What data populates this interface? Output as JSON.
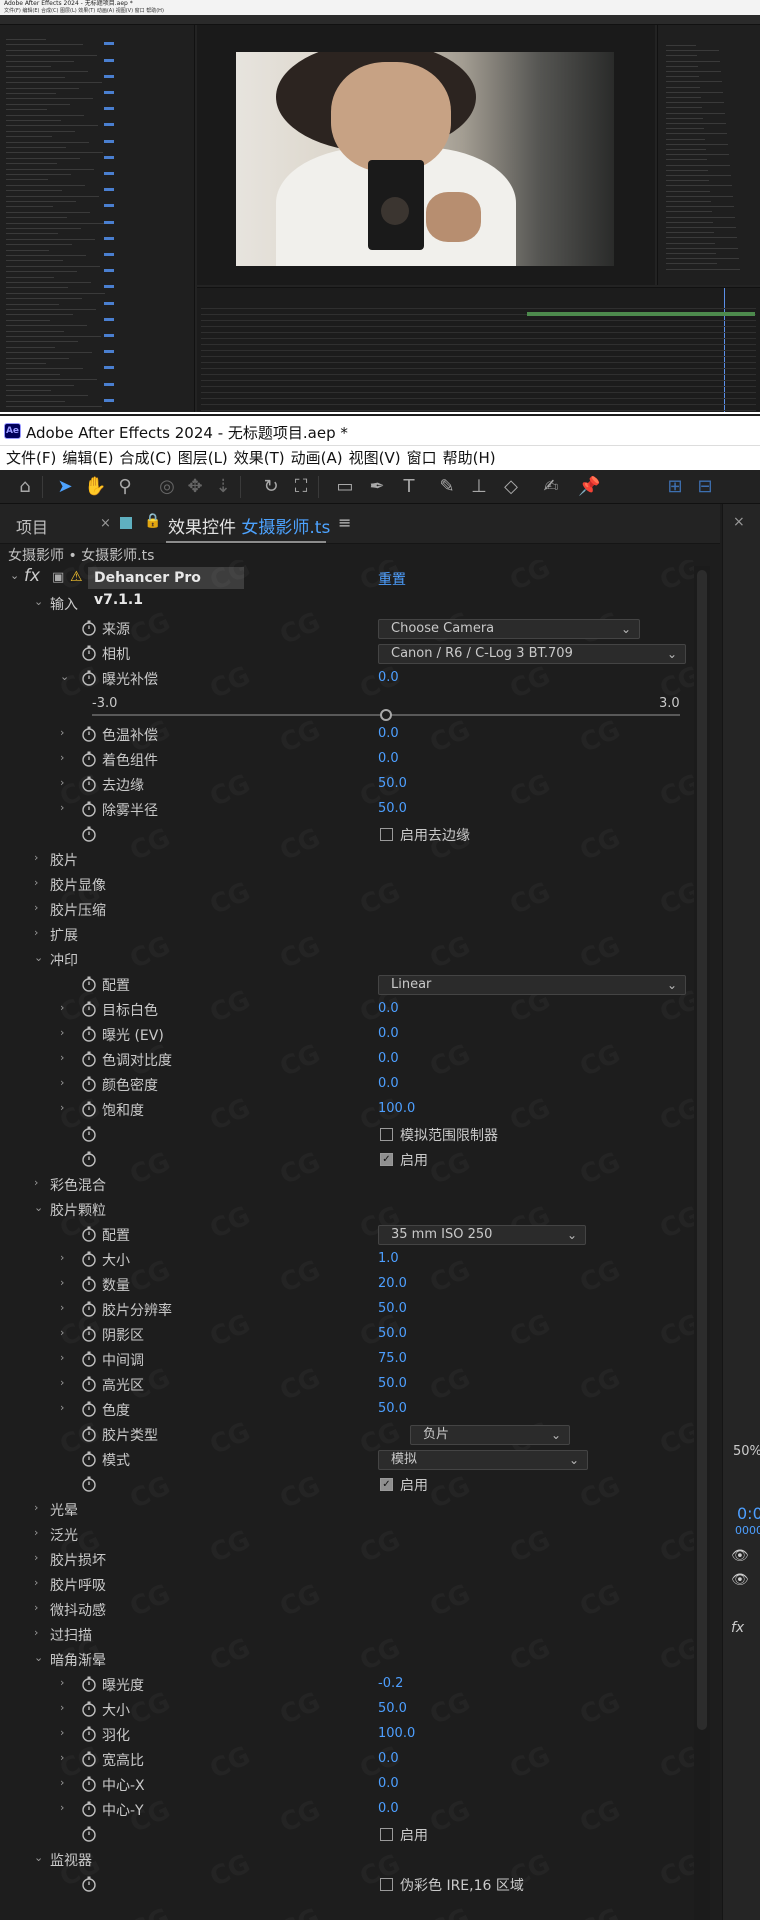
{
  "window": {
    "title": "Adobe After Effects 2024 - 无标题项目.aep *",
    "app_icon": "Ae"
  },
  "menu": [
    "文件(F)",
    "编辑(E)",
    "合成(C)",
    "图层(L)",
    "效果(T)",
    "动画(A)",
    "视图(V)",
    "窗口",
    "帮助(H)"
  ],
  "thumbnail": {
    "title": "Adobe After Effects 2024 - 无标题项目.aep *",
    "menu": "文件(F) 编辑(E) 合成(C) 图层(L) 效果(T) 动画(A) 视图(V) 窗口 帮助(H)"
  },
  "panel": {
    "project_tab": "项目",
    "effects_tab_prefix": "效果控件",
    "layer_name": "女摄影师.ts",
    "breadcrumb": "女摄影师 • 女摄影师.ts",
    "effect_name": "Dehancer Pro v7.1.1",
    "reset": "重置"
  },
  "right_strip": {
    "zoom": "50%",
    "timecode": "0:0",
    "frames": "0000"
  },
  "sections": {
    "input": "输入",
    "film": "胶片",
    "film_dev": "胶片显像",
    "film_comp": "胶片压缩",
    "expand": "扩展",
    "print": "冲印",
    "color_mix": "彩色混合",
    "grain": "胶片颗粒",
    "halation": "光晕",
    "bloom": "泛光",
    "damage": "胶片损坏",
    "breath": "胶片呼吸",
    "gate_weave": "微抖动感",
    "overscan": "过扫描",
    "vignette": "暗角渐晕",
    "monitor": "监视器"
  },
  "input": {
    "source_label": "来源",
    "source_value": "Choose Camera",
    "camera_label": "相机",
    "camera_value": "Canon / R6 / C-Log 3 BT.709",
    "exposure_label": "曝光补偿",
    "exposure_value": "0.0",
    "exposure_min": "-3.0",
    "exposure_max": "3.0",
    "exposure_fraction": 0.5,
    "temp_label": "色温补偿",
    "temp_value": "0.0",
    "tint_label": "着色组件",
    "tint_value": "0.0",
    "edge_label": "去边缘",
    "edge_value": "50.0",
    "dehaze_label": "除雾半径",
    "dehaze_value": "50.0",
    "enable_edge_label": "启用去边缘",
    "enable_edge": false
  },
  "print": {
    "config_label": "配置",
    "config_value": "Linear",
    "white_label": "目标白色",
    "white_value": "0.0",
    "ev_label": "曝光 (EV)",
    "ev_value": "0.0",
    "contrast_label": "色调对比度",
    "contrast_value": "0.0",
    "density_label": "颜色密度",
    "density_value": "0.0",
    "saturation_label": "饱和度",
    "saturation_value": "100.0",
    "limiter_label": "模拟范围限制器",
    "limiter": false,
    "enable_label": "启用",
    "enable": true
  },
  "grain": {
    "config_label": "配置",
    "config_value": "35 mm ISO 250",
    "size_label": "大小",
    "size_value": "1.0",
    "amount_label": "数量",
    "amount_value": "20.0",
    "res_label": "胶片分辨率",
    "res_value": "50.0",
    "shadows_label": "阴影区",
    "shadows_value": "50.0",
    "mids_label": "中间调",
    "mids_value": "75.0",
    "highs_label": "高光区",
    "highs_value": "50.0",
    "chroma_label": "色度",
    "chroma_value": "50.0",
    "type_label": "胶片类型",
    "type_value": "负片",
    "mode_label": "模式",
    "mode_value": "模拟",
    "enable_label": "启用",
    "enable": true
  },
  "vignette": {
    "exposure_label": "曝光度",
    "exposure_value": "-0.2",
    "size_label": "大小",
    "size_value": "50.0",
    "feather_label": "羽化",
    "feather_value": "100.0",
    "aspect_label": "宽高比",
    "aspect_value": "0.0",
    "cx_label": "中心-X",
    "cx_value": "0.0",
    "cy_label": "中心-Y",
    "cy_value": "0.0",
    "enable_label": "启用",
    "enable": false
  },
  "monitor": {
    "false_color_label": "伪彩色 IRE,16 区域",
    "false_color": false
  },
  "colors": {
    "accent": "#4d9fff",
    "background": "#1d1d1d",
    "warning": "#f2c12e"
  }
}
